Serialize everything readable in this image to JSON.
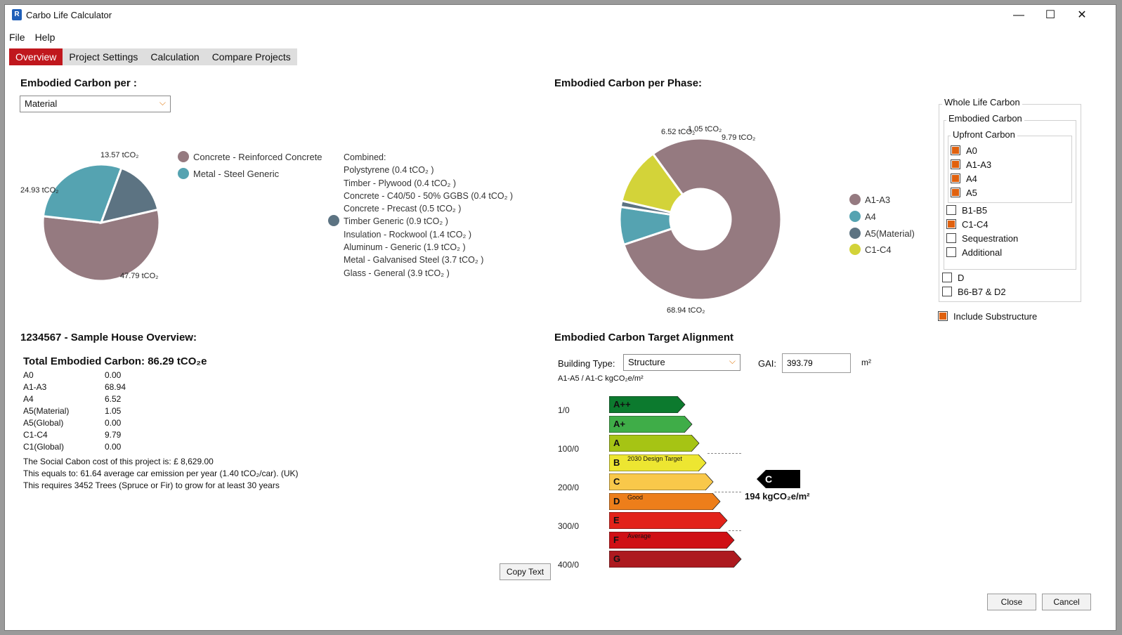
{
  "window": {
    "title": "Carbo Life Calculator",
    "minimize": "—",
    "maximize": "☐",
    "close": "✕"
  },
  "menu": {
    "file": "File",
    "help": "Help"
  },
  "tabs": [
    "Overview",
    "Project Settings",
    "Calculation",
    "Compare Projects"
  ],
  "material_panel": {
    "heading": "Embodied Carbon per :",
    "dropdown_value": "Material",
    "legend": [
      "Concrete - Reinforced Concrete",
      "Metal - Steel Generic"
    ],
    "combined_title": "Combined:",
    "combined_items": [
      "Polystyrene (0.4 tCO₂ )",
      "Timber - Plywood (0.4 tCO₂ )",
      "Concrete - C40/50 - 50% GGBS (0.4 tCO₂ )",
      "Concrete - Precast (0.5 tCO₂ )",
      "Timber Generic (0.9 tCO₂ )",
      "Insulation - Rockwool (1.4 tCO₂ )",
      "Aluminum - Generic (1.9 tCO₂ )",
      "Metal - Galvanised Steel (3.7 tCO₂ )",
      "Glass - General (3.9 tCO₂ )"
    ],
    "label_concrete": "47.79 tCO₂",
    "label_steel": "24.93 tCO₂",
    "label_combined": "13.57 tCO₂"
  },
  "phase_panel": {
    "heading": "Embodied Carbon per Phase:",
    "legend": [
      "A1-A3",
      "A4",
      "A5(Material)",
      "C1-C4"
    ],
    "label_a1a3": "68.94 tCO₂",
    "label_a4": "6.52 tCO₂",
    "label_a5": "1.05 tCO₂",
    "label_c1c4": "9.79 tCO₂"
  },
  "filters": {
    "whole_life": "Whole Life Carbon",
    "embodied": "Embodied Carbon",
    "upfront": "Upfront Carbon",
    "upfront_items": [
      {
        "label": "A0",
        "checked": true
      },
      {
        "label": "A1-A3",
        "checked": true
      },
      {
        "label": "A4",
        "checked": true
      },
      {
        "label": "A5",
        "checked": true
      }
    ],
    "embodied_items": [
      {
        "label": "B1-B5",
        "checked": false
      },
      {
        "label": "C1-C4",
        "checked": true
      },
      {
        "label": "Sequestration",
        "checked": false
      },
      {
        "label": "Additional",
        "checked": false
      }
    ],
    "wlc_items": [
      {
        "label": "D",
        "checked": false
      },
      {
        "label": "B6-B7 & D2",
        "checked": false
      }
    ],
    "include_substructure": "Include Substructure"
  },
  "overview": {
    "heading": "1234567 - Sample House Overview:",
    "total": "Total Embodied Carbon: 86.29 tCO₂e",
    "rows": [
      {
        "label": "A0",
        "value": "0.00"
      },
      {
        "label": "A1-A3",
        "value": "68.94"
      },
      {
        "label": "A4",
        "value": "6.52"
      },
      {
        "label": "A5(Material)",
        "value": "1.05"
      },
      {
        "label": "A5(Global)",
        "value": "0.00"
      },
      {
        "label": "C1-C4",
        "value": "9.79"
      },
      {
        "label": "C1(Global)",
        "value": "0.00"
      }
    ],
    "social_cost": "The Social Cabon cost of this project is: £ 8,629.00",
    "car_equiv": "This equals to: 61.64 average car emission per year (1.40 tCO₂/car). (UK)",
    "trees": "This requires 3452 Trees (Spruce or Fir) to grow for at least 30 years",
    "copy_button": "Copy Text"
  },
  "target": {
    "heading": "Embodied Carbon Target Alignment",
    "building_type_label": "Building Type:",
    "building_type_value": "Structure",
    "gai_label": "GAI:",
    "gai_value": "393.79",
    "gai_unit": "m²",
    "subheading": "A1-A5 / A1-C kgCO₂e/m²",
    "y_labels": [
      "1/0",
      "100/0",
      "200/0",
      "300/0",
      "400/0"
    ],
    "bands": [
      "A++",
      "A+",
      "A",
      "B",
      "C",
      "D",
      "E",
      "F",
      "G"
    ],
    "notes": {
      "B": "2030 Design Target",
      "D": "Good",
      "F": "Average"
    },
    "result_letter": "C",
    "result_value": "194 kgCO₂e/m²"
  },
  "buttons": {
    "close": "Close",
    "cancel": "Cancel"
  },
  "chart_data": [
    {
      "type": "pie",
      "title": "Embodied Carbon per :",
      "categories": [
        "Concrete - Reinforced Concrete",
        "Metal - Steel Generic",
        "Combined"
      ],
      "values": [
        47.79,
        24.93,
        13.57
      ],
      "colors": [
        "#957a80",
        "#55a3b1",
        "#5c7382"
      ]
    },
    {
      "type": "pie",
      "title": "Embodied Carbon per Phase:",
      "categories": [
        "A1-A3",
        "A4",
        "A5(Material)",
        "C1-C4"
      ],
      "values": [
        68.94,
        6.52,
        1.05,
        9.79
      ],
      "colors": [
        "#957a80",
        "#55a3b1",
        "#5c7382",
        "#d3d339"
      ]
    }
  ],
  "colors": {
    "tab_active": "#c0171d",
    "checkbox": "#e0610e",
    "bands": [
      "#0c7a2e",
      "#3fad48",
      "#a6c414",
      "#ede631",
      "#f9c84a",
      "#ed7e1a",
      "#e2231a",
      "#cf1015",
      "#ad1a1f"
    ]
  }
}
